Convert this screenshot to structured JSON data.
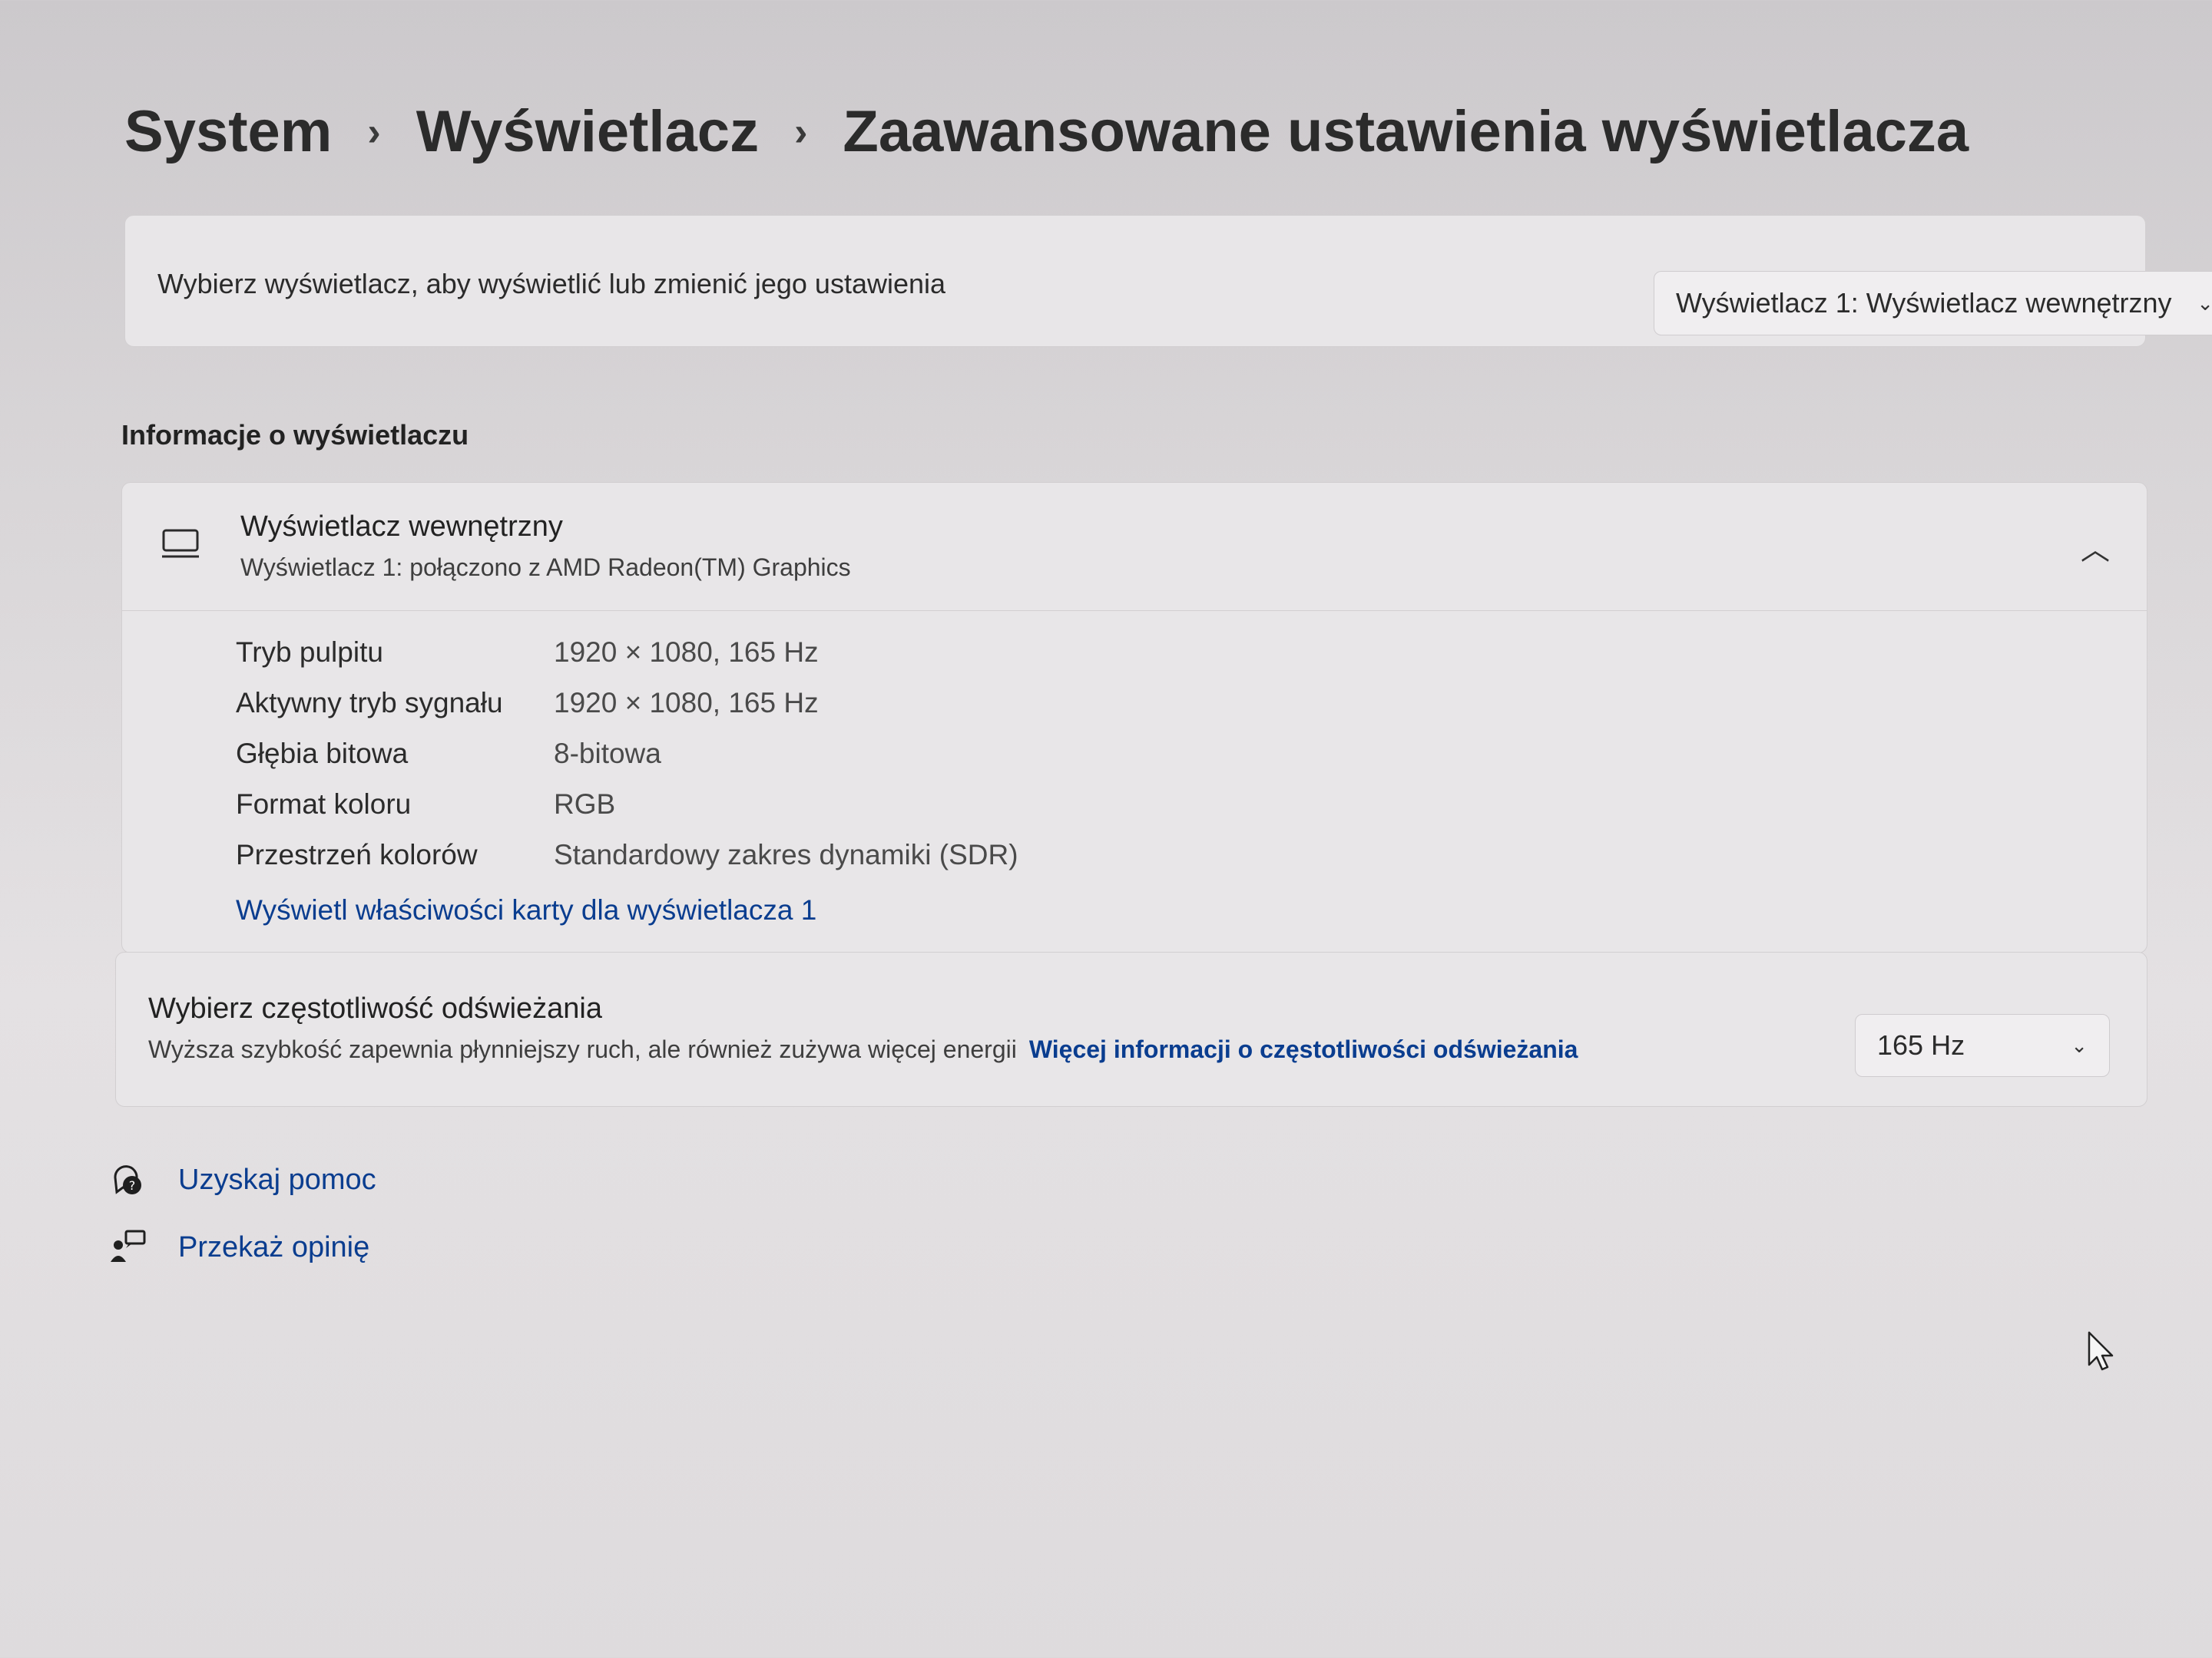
{
  "breadcrumb": {
    "items": [
      "System",
      "Wyświetlacz",
      "Zaawansowane ustawienia wyświetlacza"
    ],
    "separator": "›"
  },
  "select_display": {
    "label": "Wybierz wyświetlacz, aby wyświetlić lub zmienić jego ustawienia",
    "dropdown_value": "Wyświetlacz 1: Wyświetlacz wewnętrzny"
  },
  "display_info": {
    "section_title": "Informacje o wyświetlaczu",
    "title": "Wyświetlacz wewnętrzny",
    "subtitle": "Wyświetlacz 1: połączono z AMD Radeon(TM) Graphics",
    "icon": "monitor-icon",
    "expanded": true,
    "properties": [
      {
        "label": "Tryb pulpitu",
        "value": "1920 × 1080, 165 Hz"
      },
      {
        "label": "Aktywny tryb sygnału",
        "value": "1920 × 1080, 165 Hz"
      },
      {
        "label": "Głębia bitowa",
        "value": "8-bitowa"
      },
      {
        "label": "Format koloru",
        "value": "RGB"
      },
      {
        "label": "Przestrzeń kolorów",
        "value": "Standardowy zakres dynamiki (SDR)"
      }
    ],
    "adapter_link": "Wyświetl właściwości karty dla wyświetlacza 1"
  },
  "refresh_rate": {
    "title": "Wybierz częstotliwość odświeżania",
    "description": "Wyższa szybkość zapewnia płynniejszy ruch, ale również zużywa więcej energii",
    "link": "Więcej informacji o częstotliwości odświeżania",
    "dropdown_value": "165 Hz"
  },
  "footer_links": [
    {
      "label": "Uzyskaj pomoc",
      "icon": "help-icon"
    },
    {
      "label": "Przekaż opinię",
      "icon": "feedback-icon"
    }
  ],
  "colors": {
    "link": "#0a3d8f",
    "card_bg": "#e8e6e8",
    "page_bg": "#d9d6d8"
  }
}
